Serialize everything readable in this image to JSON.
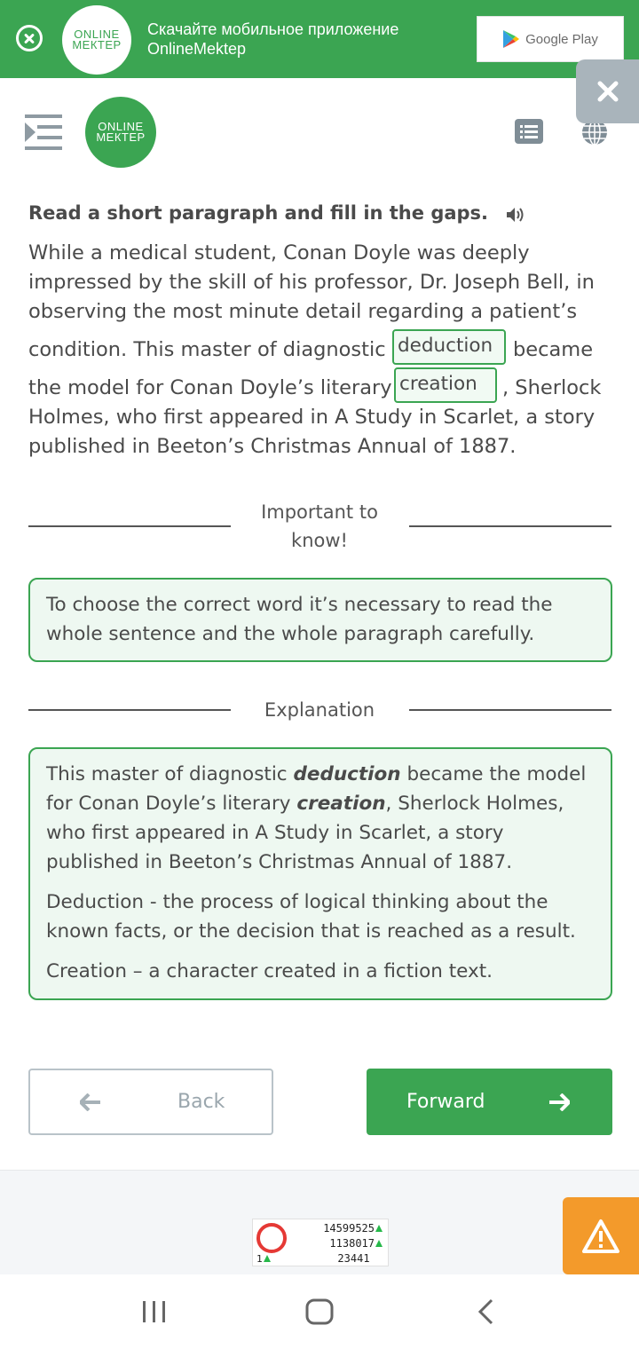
{
  "banner": {
    "logo_line1": "ONLINE",
    "logo_line2": "МЕКТЕР",
    "text_line1": "Скачайте мобильное приложение",
    "text_line2": "OnlineMektep",
    "store_label": "Google Play"
  },
  "header": {
    "logo_line1": "ONLINE",
    "logo_line2": "МЕКТЕР"
  },
  "task": {
    "title": "Read a short paragraph and fill in the gaps.",
    "lines": [
      "While a medical student, Conan Doyle was deeply",
      "impressed by the skill of his professor, Dr. Joseph Bell, in",
      "observing the most minute detail regarding a patient’s",
      "condition. This master of diagnostic",
      "became",
      "the model for Conan Doyle’s literary",
      ", Sherlock",
      "Holmes, who first appeared in A Study in Scarlet, a story",
      "published in Beeton’s Christmas Annual of 1887."
    ],
    "gap1_value": "deduction",
    "gap2_value": "creation"
  },
  "important": {
    "heading_line1": "Important to",
    "heading_line2": "know!",
    "text": "To choose the correct word it’s necessary to read the whole sentence and the whole paragraph carefully."
  },
  "explanation": {
    "heading": "Explanation",
    "p1_before": "This master of diagnostic ",
    "p1_word1": "deduction",
    "p1_mid": " became the model for Conan Doyle’s literary ",
    "p1_word2": "creation",
    "p1_after": ", Sherlock Holmes, who first appeared in A Study in Scarlet, a story published in Beeton’s Christmas Annual of 1887.",
    "p2": "Deduction - the process of logical thinking about the known facts, or the decision that is reached as a result.",
    "p3": "Creation – a character created in a fiction text."
  },
  "nav": {
    "back_label": "Back",
    "forward_label": "Forward"
  },
  "counter": {
    "row1": "14599525",
    "row2": "1138017",
    "row3": "23441",
    "small": "1"
  },
  "colors": {
    "brand_green": "#3ba552",
    "warning_orange": "#f39a2b"
  }
}
